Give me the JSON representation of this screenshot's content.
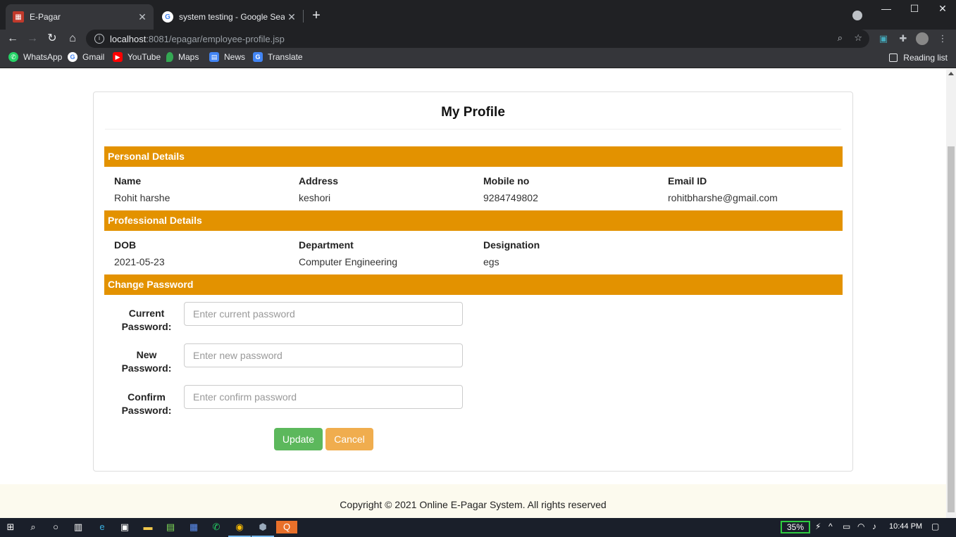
{
  "browser": {
    "tabs": [
      {
        "title": "E-Pagar",
        "active": true
      },
      {
        "title": "system testing - Google Search",
        "active": false
      }
    ],
    "url_host": "localhost",
    "url_rest": ":8081/epagar/employee-profile.jsp",
    "bookmarks": [
      "WhatsApp",
      "Gmail",
      "YouTube",
      "Maps",
      "News",
      "Translate"
    ],
    "reading_list": "Reading list"
  },
  "page": {
    "title": "My Profile",
    "sections": {
      "personal": "Personal Details",
      "professional": "Professional Details",
      "password": "Change Password"
    },
    "personal": [
      {
        "label": "Name",
        "value": "Rohit harshe"
      },
      {
        "label": "Address",
        "value": "keshori"
      },
      {
        "label": "Mobile no",
        "value": "9284749802"
      },
      {
        "label": "Email ID",
        "value": "rohitbharshe@gmail.com"
      }
    ],
    "professional": [
      {
        "label": "DOB",
        "value": "2021-05-23"
      },
      {
        "label": "Department",
        "value": "Computer Engineering"
      },
      {
        "label": "Designation",
        "value": "egs"
      }
    ],
    "password_form": {
      "current_label_1": "Current",
      "current_label_2": "Password:",
      "current_placeholder": "Enter current password",
      "new_label_1": "New",
      "new_label_2": "Password:",
      "new_placeholder": "Enter new password",
      "confirm_label_1": "Confirm",
      "confirm_label_2": "Password:",
      "confirm_placeholder": "Enter confirm password",
      "update_label": "Update",
      "cancel_label": "Cancel"
    },
    "footer": "Copyright © 2021 Online E-Pagar System. All rights reserved"
  },
  "taskbar": {
    "battery": "35%",
    "time": "10:44 PM"
  },
  "colors": {
    "section_bar": "#e39200",
    "update_button": "#5cb85c",
    "cancel_button": "#f0ad4e",
    "footer_bg": "#fcfaee"
  }
}
